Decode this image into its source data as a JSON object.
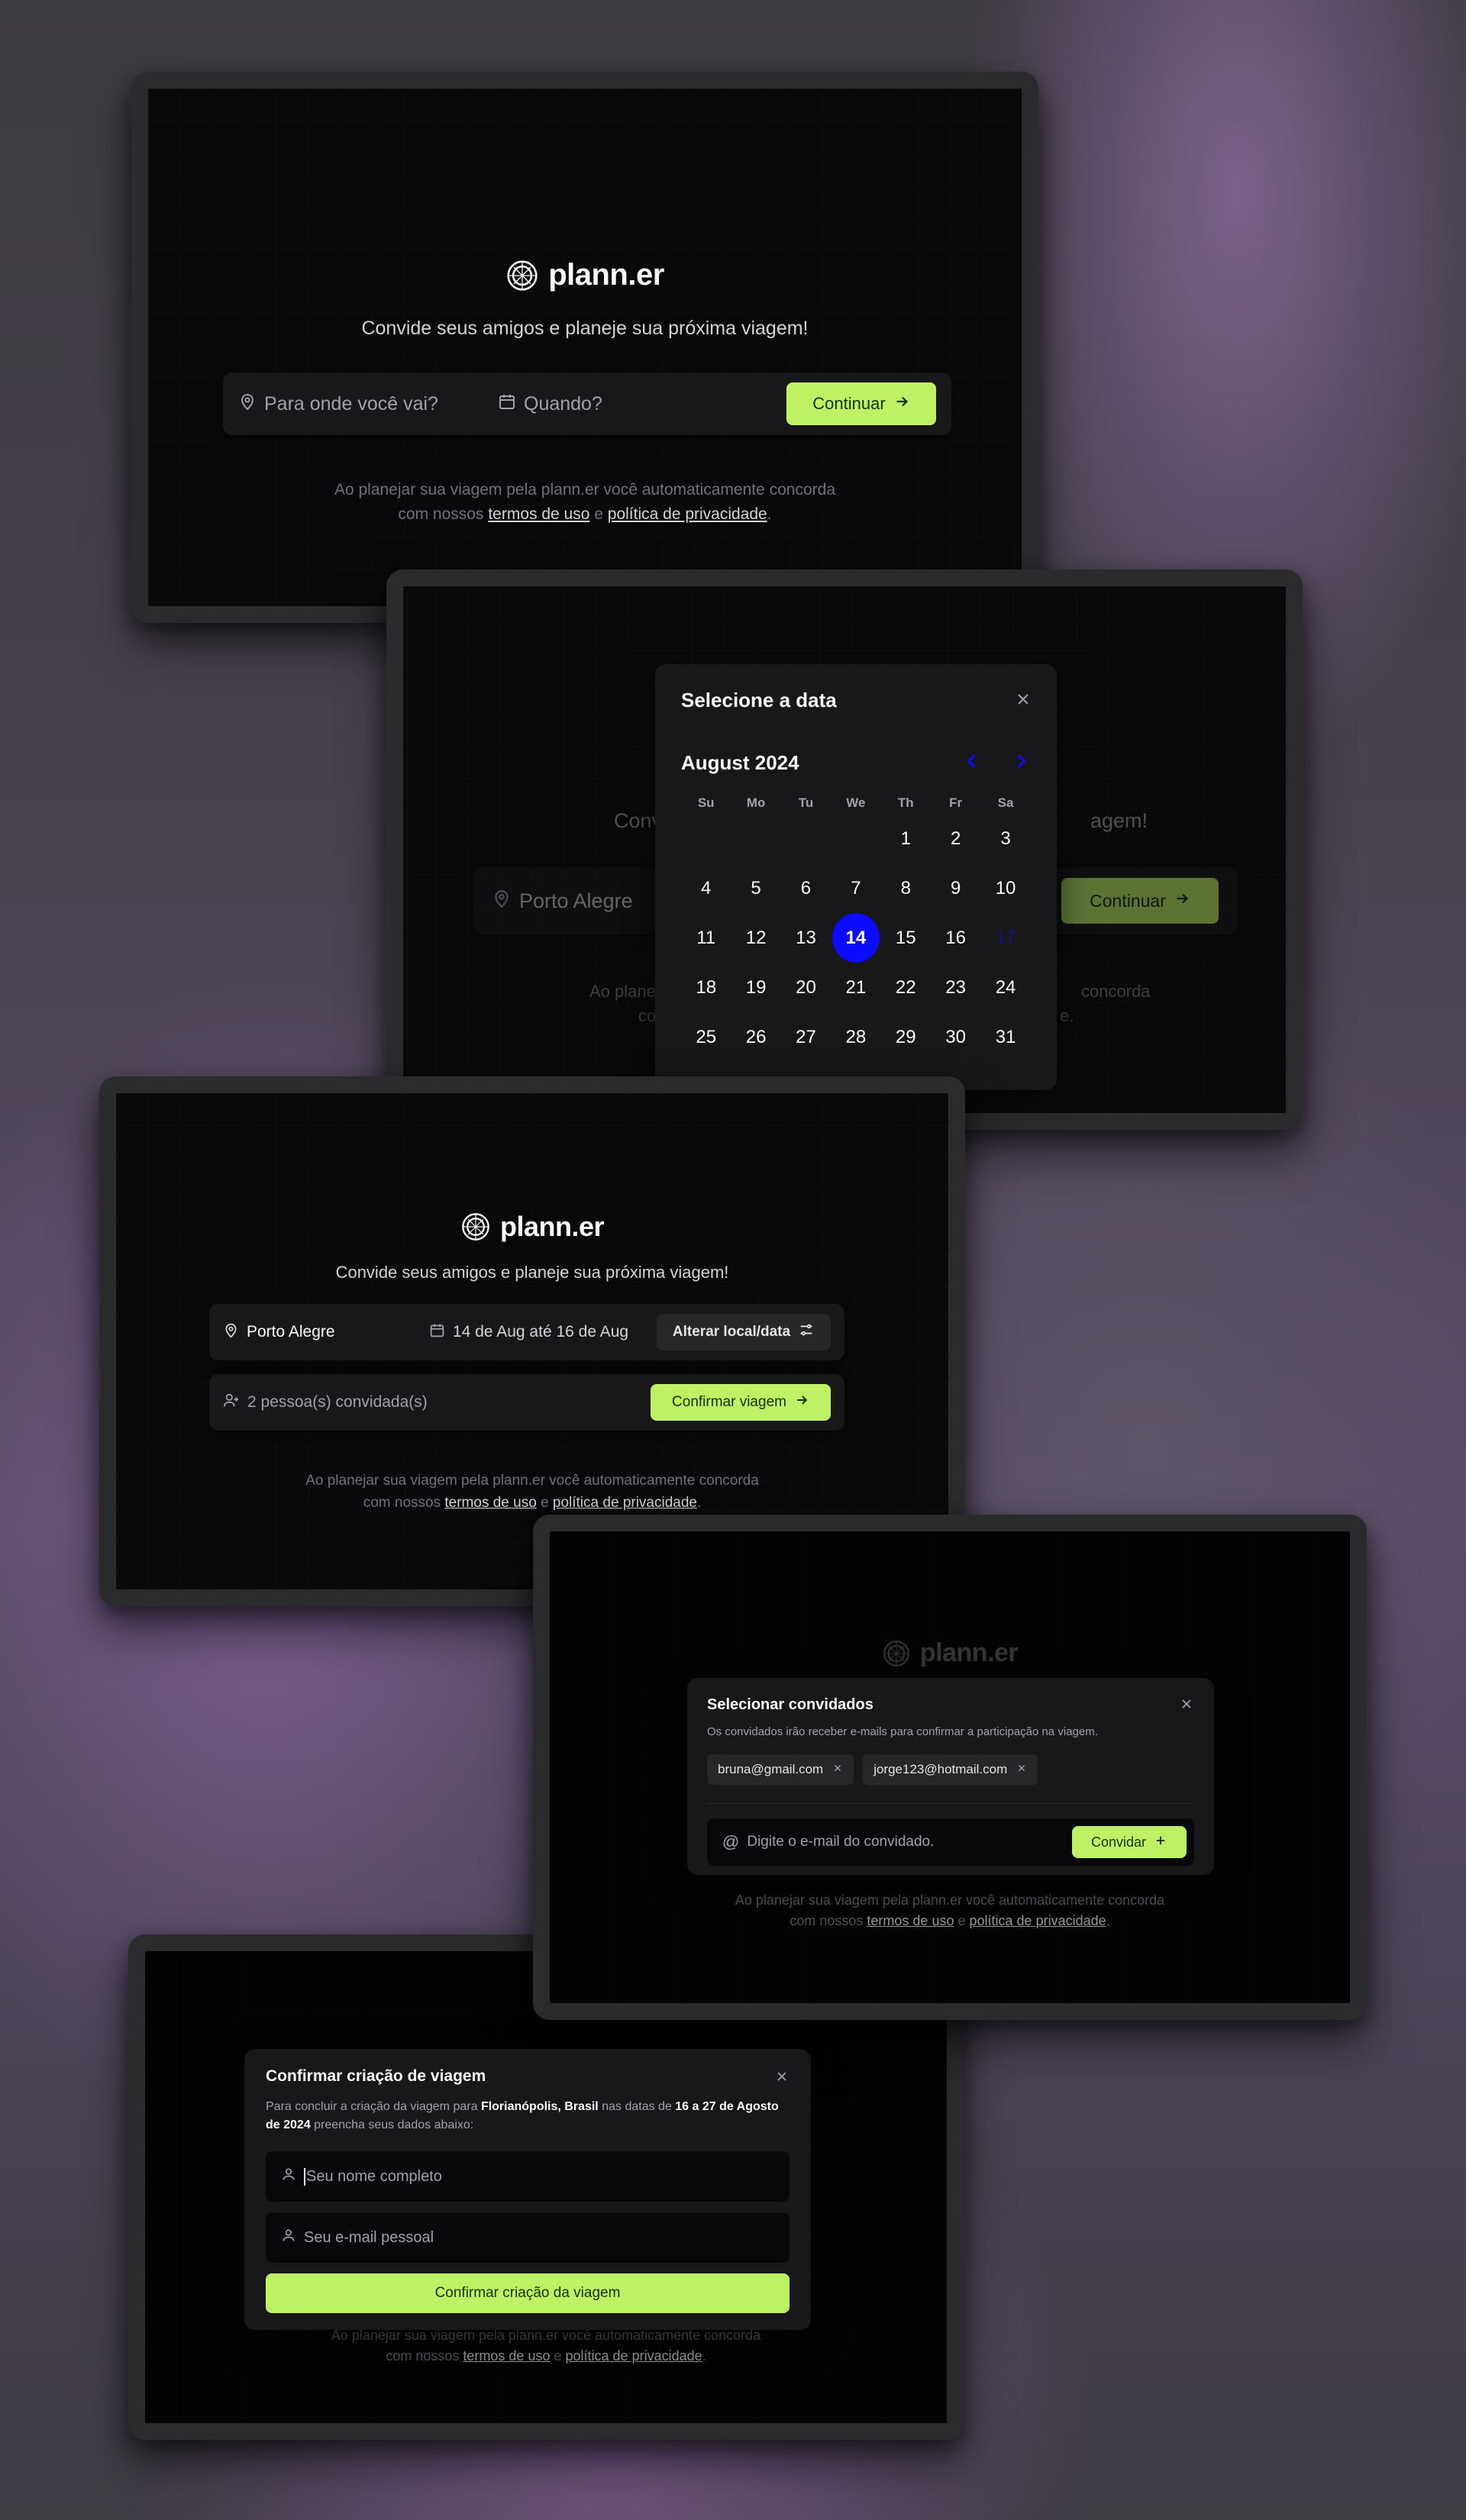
{
  "app": {
    "name": "plann.er",
    "tagline": "Convide seus amigos e planeje sua próxima viagem!"
  },
  "icons": {
    "logo": "globe-icon",
    "location": "map-pin-icon",
    "calendar": "calendar-icon",
    "arrow": "arrow-right-icon",
    "close": "x-icon",
    "settings": "settings-2-icon",
    "user": "user-icon",
    "user_plus": "user-plus-icon",
    "at": "at-sign-icon",
    "plus": "plus-icon"
  },
  "colors": {
    "accent": "#bef264",
    "selected_day": "#0b0bff",
    "background": "#09090b",
    "panel": "#18181b"
  },
  "terms": {
    "prefix": "Ao planejar sua viagem pela plann.er você automaticamente concorda",
    "mid": "com nossos",
    "link_terms": "termos de uso",
    "and": "e",
    "link_privacy": "política de privacidade",
    "end": "."
  },
  "screen1": {
    "destination_placeholder": "Para onde você vai?",
    "when_placeholder": "Quando?",
    "continue_label": "Continuar"
  },
  "screen2": {
    "destination_value": "Porto Alegre",
    "continue_label": "Continuar",
    "tagline_left": "Conv",
    "tagline_right": "agem!",
    "terms_left": "Ao planeja",
    "terms_right": "concorda",
    "terms2_left": "co",
    "terms2_right": "e.",
    "modal": {
      "title": "Selecione a data",
      "month": "August 2024",
      "weekdays": [
        "Su",
        "Mo",
        "Tu",
        "We",
        "Th",
        "Fr",
        "Sa"
      ],
      "days": [
        "",
        "",
        "",
        "",
        "1",
        "2",
        "3",
        "4",
        "5",
        "6",
        "7",
        "8",
        "9",
        "10",
        "11",
        "12",
        "13",
        "14",
        "15",
        "16",
        "17",
        "18",
        "19",
        "20",
        "21",
        "22",
        "23",
        "24",
        "25",
        "26",
        "27",
        "28",
        "29",
        "30",
        "31"
      ],
      "selected": "14",
      "faded": "17"
    }
  },
  "screen3": {
    "destination": "Porto Alegre",
    "dates": "14 de Aug até 16 de Aug",
    "change_label": "Alterar local/data",
    "guests": "2 pessoa(s) convidada(s)",
    "confirm_label": "Confirmar viagem"
  },
  "screen4": {
    "modal": {
      "title": "Selecionar convidados",
      "description": "Os convidados irão receber e-mails para confirmar a participação na viagem.",
      "emails": [
        "bruna@gmail.com",
        "jorge123@hotmail.com"
      ],
      "input_placeholder": "Digite o e-mail do convidado.",
      "invite_label": "Convidar"
    }
  },
  "screen5": {
    "modal": {
      "title": "Confirmar criação de viagem",
      "desc_prefix": "Para concluir a criação da viagem para",
      "destination": "Florianópolis, Brasil",
      "desc_mid": "nas datas de",
      "dates": "16 a 27 de Agosto de 2024",
      "desc_suffix": "preencha seus dados abaixo:",
      "name_placeholder": "Seu nome completo",
      "email_placeholder": "Seu e-mail pessoal",
      "submit_label": "Confirmar criação da viagem"
    }
  }
}
